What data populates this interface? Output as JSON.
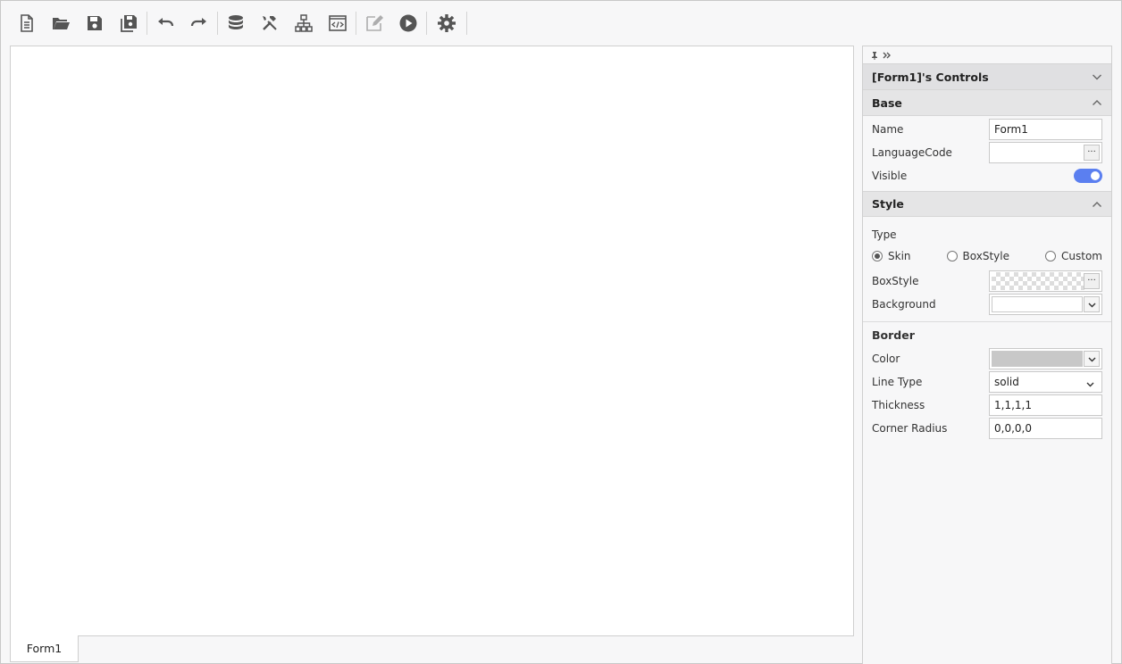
{
  "toolbar": {
    "buttons": [
      {
        "name": "new-file-icon"
      },
      {
        "name": "open-folder-icon"
      },
      {
        "name": "save-icon"
      },
      {
        "name": "save-all-icon"
      },
      {
        "name": "undo-icon"
      },
      {
        "name": "redo-icon"
      },
      {
        "name": "database-icon"
      },
      {
        "name": "tools-icon"
      },
      {
        "name": "hierarchy-icon"
      },
      {
        "name": "code-view-icon"
      },
      {
        "name": "edit-icon"
      },
      {
        "name": "run-icon"
      },
      {
        "name": "settings-icon"
      }
    ]
  },
  "tabs": [
    {
      "label": "Form1"
    }
  ],
  "panel": {
    "controls_title": "[Form1]'s Controls",
    "base": {
      "title": "Base",
      "name_label": "Name",
      "name_value": "Form1",
      "language_label": "LanguageCode",
      "language_value": "",
      "visible_label": "Visible",
      "visible_on": true
    },
    "style": {
      "title": "Style",
      "type_label": "Type",
      "type_options": [
        "Skin",
        "BoxStyle",
        "Custom"
      ],
      "type_selected": "Skin",
      "boxstyle_label": "BoxStyle",
      "background_label": "Background",
      "background_color": "#ffffff"
    },
    "border": {
      "title": "Border",
      "color_label": "Color",
      "color_value": "#c8c8c8",
      "line_type_label": "Line Type",
      "line_type_value": "solid",
      "thickness_label": "Thickness",
      "thickness_value": "1,1,1,1",
      "corner_radius_label": "Corner Radius",
      "corner_radius_value": "0,0,0,0"
    },
    "ellipsis": "···"
  },
  "colors": {
    "accent": "#5b7ff0",
    "icon": "#555555"
  }
}
